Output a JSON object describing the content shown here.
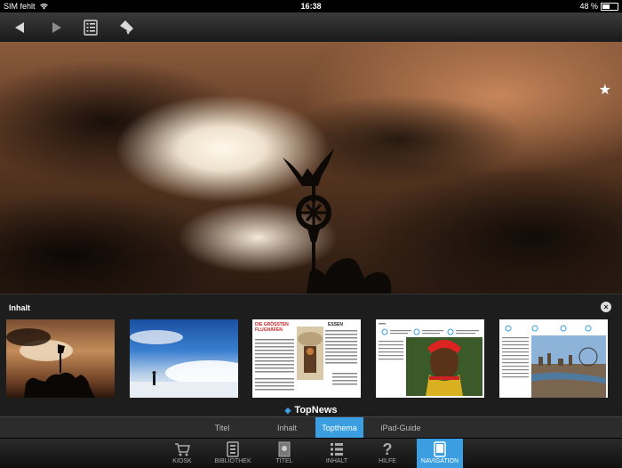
{
  "status": {
    "carrier": "SIM fehlt",
    "time": "16:38",
    "battery": "48 %",
    "battery_level": 0.48
  },
  "toolbar": {
    "buttons": [
      "back-icon",
      "forward-icon",
      "list-icon",
      "bookmark-icon"
    ]
  },
  "panel": {
    "title": "Inhalt",
    "section_label": "TopNews",
    "close_icon": "close-icon"
  },
  "tabs": [
    "Titel",
    "Inhalt",
    "Topthema",
    "iPad-Guide"
  ],
  "active_tab": "Topthema",
  "bottom_nav": {
    "kiosk": "KIOSK",
    "bibliothek": "BIBLIOTHEK",
    "titel": "TITEL",
    "inhalt": "INHALT",
    "hilfe": "HILFE",
    "navigation": "NAVIGATION"
  },
  "thumbnails": {
    "t3": {
      "headline": "DIE GRÖSSTEN FLUGHÄFEN",
      "side": "ESSEN"
    }
  },
  "colors": {
    "accent": "#3a9ee0"
  }
}
